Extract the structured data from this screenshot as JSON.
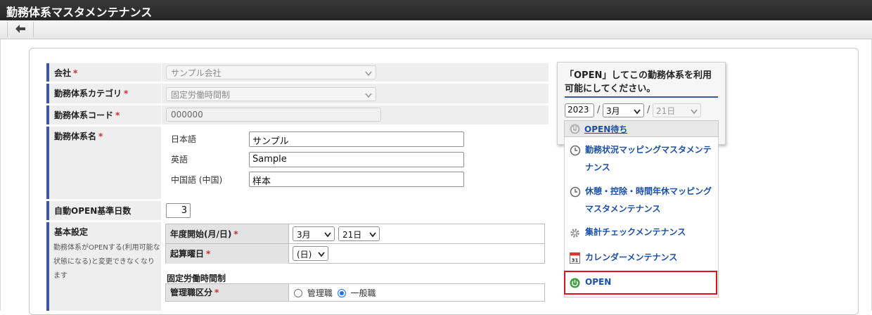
{
  "app": {
    "title": "勤務体系マスタメンテナンス"
  },
  "toolbar": {
    "back_icon": "arrow-left-icon"
  },
  "form": {
    "company": {
      "label": "会社",
      "required_mark": "*",
      "value": "サンプル会社"
    },
    "category": {
      "label": "勤務体系カテゴリ",
      "required_mark": "*",
      "value": "固定労働時間制"
    },
    "code": {
      "label": "勤務体系コード",
      "required_mark": "*",
      "value": "000000"
    },
    "name": {
      "label": "勤務体系名",
      "required_mark": "*",
      "languages": [
        {
          "label": "日本語",
          "value": "サンプル"
        },
        {
          "label": "英語",
          "value": "Sample"
        },
        {
          "label": "中国語 (中国)",
          "value": "样本"
        }
      ]
    },
    "auto_open": {
      "label": "自動OPEN基準日数",
      "value": "3"
    },
    "basic": {
      "label": "基本設定",
      "help": "勤務体系がOPENする(利用可能な状態になる)と変更できなくなります",
      "fiscal_start": {
        "label": "年度開始(月/日)",
        "required_mark": "*",
        "month": "3月",
        "day": "21日"
      },
      "start_weekday": {
        "label": "起算曜日",
        "required_mark": "*",
        "value": "(日)"
      },
      "fixed_section_title": "固定労働時間制",
      "manager_class": {
        "label": "管理職区分",
        "required_mark": "*",
        "options": [
          {
            "label": "管理職",
            "selected": false
          },
          {
            "label": "一般職",
            "selected": true
          }
        ]
      }
    }
  },
  "open_panel": {
    "message": "「OPEN」してこの勤務体系を利用可能にしてください。",
    "year": "2023",
    "slash": "/",
    "month": "3月",
    "day": "21日",
    "status": "OPEN待ち",
    "menu": [
      {
        "icon": "clock-icon",
        "label_line1": "勤務状況マッピングマスタメンテ",
        "label_line2": "ナンス"
      },
      {
        "icon": "clock-icon",
        "label_line1": "休憩・控除・時間年休マッピング",
        "label_line2": "マスタメンテナンス"
      },
      {
        "icon": "gear-icon",
        "label": "集計チェックメンテナンス"
      },
      {
        "icon": "calendar-icon",
        "label": "カレンダーメンテナンス",
        "calendar_day": "31"
      },
      {
        "icon": "power-icon",
        "label": "OPEN"
      }
    ]
  },
  "colors": {
    "title_bar": "#262626",
    "accent_blue": "#3d57a6",
    "link_blue": "#1b4fa8",
    "required_red": "#d62b2b",
    "highlight_red": "#d0191f"
  }
}
